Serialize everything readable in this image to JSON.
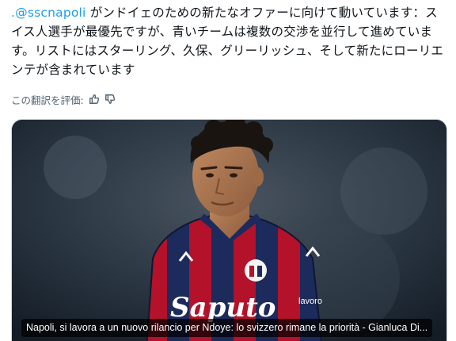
{
  "tweet": {
    "mention": ".@sscnapoli",
    "text_after_mention": " がンドイェのための新たなオファーに向けて動いています：スイス人選手が最優先ですが、青いチームは複数の交渉を並行して進めています。リストにはスターリング、久保、グリーリッシュ、そして新たにローリエンテが含まれています"
  },
  "translation_rating": {
    "label": "この翻訳を評価:",
    "thumbs_up_icon": "thumbs-up-icon",
    "thumbs_down_icon": "thumbs-down-icon"
  },
  "media_card": {
    "caption": "Napoli, si lavora a un nuovo rilancio per Ndoye: lo svizzero rimane la priorità - Gianluca Di...",
    "jersey_sponsor": "Saputo",
    "jersey_brand": "lavoro"
  },
  "colors": {
    "link": "#1d9bf0",
    "text": "#0f1419",
    "muted": "#536471",
    "jersey_red": "#b3122a",
    "jersey_blue": "#1c2a5c"
  }
}
